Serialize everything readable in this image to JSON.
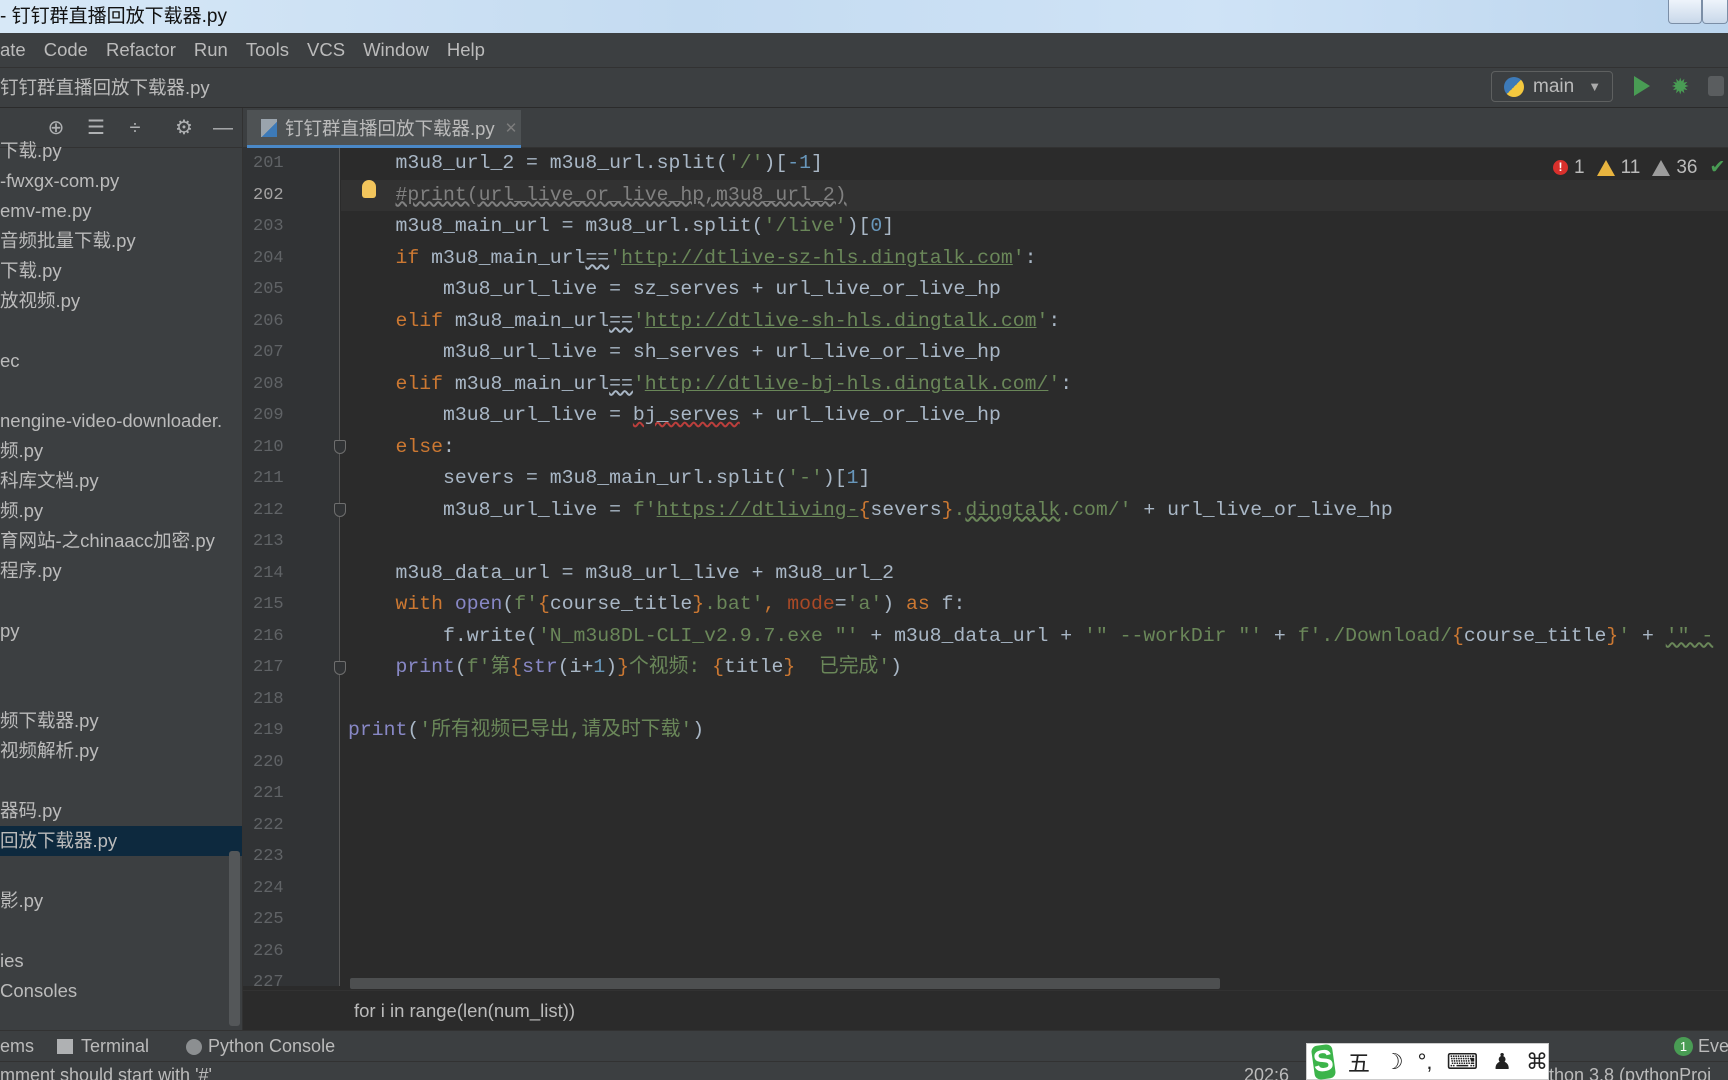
{
  "window": {
    "title": "- 钉钉群直播回放下载器.py"
  },
  "menu": [
    "ate",
    "Code",
    "Refactor",
    "Run",
    "Tools",
    "VCS",
    "Window",
    "Help"
  ],
  "navbar": {
    "file": "钉钉群直播回放下载器.py",
    "run_config": "main"
  },
  "sidebar": {
    "items": [
      "下载.py",
      "-fwxgx-com.py",
      "emv-me.py",
      "音频批量下载.py",
      "下载.py",
      "放视频.py",
      "",
      "ec",
      "",
      "nengine-video-downloader.",
      "频.py",
      "科库文档.py",
      "频.py",
      "育网站-之chinaacc加密.py",
      "程序.py",
      "",
      "py",
      "",
      "",
      "频下载器.py",
      "视频解析.py",
      "",
      "器码.py",
      "回放下载器.py",
      "",
      "影.py",
      "",
      "ies",
      "Consoles"
    ],
    "selected_index": 23
  },
  "editor": {
    "tab": "钉钉群直播回放下载器.py",
    "current_line": 202,
    "problems": {
      "errors": "1",
      "warnings": "11",
      "weak_warnings": "36"
    },
    "lines": [
      {
        "num": "201",
        "tokens": [
          [
            "    m3u8_url_2 = m3u8_url.split(",
            "d"
          ],
          [
            "'/'",
            "s"
          ],
          [
            ")[",
            "d"
          ],
          [
            "-1",
            "n"
          ],
          [
            "]",
            "d"
          ]
        ]
      },
      {
        "num": "202",
        "tokens": [
          [
            "    ",
            "d"
          ],
          [
            "#print(url_live_or_live_hp,m3u8_url_2)",
            "cm"
          ]
        ]
      },
      {
        "num": "203",
        "tokens": [
          [
            "    m3u8_main_url = m3u8_url.split(",
            "d"
          ],
          [
            "'/live'",
            "s"
          ],
          [
            ")[",
            "d"
          ],
          [
            "0",
            "n"
          ],
          [
            "]",
            "d"
          ]
        ]
      },
      {
        "num": "204",
        "tokens": [
          [
            "    ",
            "d"
          ],
          [
            "if",
            "k"
          ],
          [
            " m3u8_main_url",
            "d"
          ],
          [
            "==",
            "d wd"
          ],
          [
            "'",
            "s"
          ],
          [
            "http://dtlive-sz-hls.dingtalk.com",
            "s link"
          ],
          [
            "'",
            "s"
          ],
          [
            ":",
            "d"
          ]
        ]
      },
      {
        "num": "205",
        "tokens": [
          [
            "        m3u8_url_live = sz_serves + url_live_or_live_hp",
            "d"
          ]
        ]
      },
      {
        "num": "206",
        "tokens": [
          [
            "    ",
            "d"
          ],
          [
            "elif",
            "k"
          ],
          [
            " m3u8_main_url",
            "d"
          ],
          [
            "==",
            "d wd"
          ],
          [
            "'",
            "s"
          ],
          [
            "http://dtlive-sh-hls.dingtalk.com",
            "s link"
          ],
          [
            "'",
            "s"
          ],
          [
            ":",
            "d"
          ]
        ]
      },
      {
        "num": "207",
        "tokens": [
          [
            "        m3u8_url_live = sh_serves + url_live_or_live_hp",
            "d"
          ]
        ]
      },
      {
        "num": "208",
        "tokens": [
          [
            "    ",
            "d"
          ],
          [
            "elif",
            "k"
          ],
          [
            " m3u8_main_url",
            "d"
          ],
          [
            "==",
            "d wd"
          ],
          [
            "'",
            "s"
          ],
          [
            "http://dtlive-bj-hls.dingtalk.com/",
            "s link"
          ],
          [
            "'",
            "s"
          ],
          [
            ":",
            "d"
          ]
        ]
      },
      {
        "num": "209",
        "tokens": [
          [
            "        m3u8_url_live = ",
            "d"
          ],
          [
            "bj_serves",
            "d wr"
          ],
          [
            " + url_live_or_live_hp",
            "d"
          ]
        ]
      },
      {
        "num": "210",
        "tokens": [
          [
            "    ",
            "d"
          ],
          [
            "else",
            "k"
          ],
          [
            ":",
            "d"
          ]
        ]
      },
      {
        "num": "211",
        "tokens": [
          [
            "        severs = m3u8_main_url.split(",
            "d"
          ],
          [
            "'-'",
            "s"
          ],
          [
            ")[",
            "d"
          ],
          [
            "1",
            "n"
          ],
          [
            "]",
            "d"
          ]
        ]
      },
      {
        "num": "212",
        "tokens": [
          [
            "        m3u8_url_live = ",
            "d"
          ],
          [
            "f'",
            "s"
          ],
          [
            "https://dtliving-",
            "s link"
          ],
          [
            "{",
            "k"
          ],
          [
            "severs",
            "d"
          ],
          [
            "}",
            "k"
          ],
          [
            ".",
            "s"
          ],
          [
            "dingtalk",
            "s wv"
          ],
          [
            ".com/'",
            "s"
          ],
          [
            " + url_live_or_live_hp",
            "d"
          ]
        ]
      },
      {
        "num": "213",
        "tokens": []
      },
      {
        "num": "214",
        "tokens": [
          [
            "    m3u8_data_url = m3u8_url_live + m3u8_url_2",
            "d"
          ]
        ]
      },
      {
        "num": "215",
        "tokens": [
          [
            "    ",
            "d"
          ],
          [
            "with",
            "k"
          ],
          [
            " ",
            "d"
          ],
          [
            "open",
            "b"
          ],
          [
            "(",
            "d"
          ],
          [
            "f'",
            "s"
          ],
          [
            "{",
            "k"
          ],
          [
            "course_title",
            "d"
          ],
          [
            "}",
            "k"
          ],
          [
            ".bat'",
            "s"
          ],
          [
            ", ",
            "k"
          ],
          [
            "mode",
            "p"
          ],
          [
            "=",
            "d"
          ],
          [
            "'a'",
            "s"
          ],
          [
            ") ",
            "d"
          ],
          [
            "as",
            "k"
          ],
          [
            " f:",
            "d"
          ]
        ]
      },
      {
        "num": "216",
        "tokens": [
          [
            "        f.write(",
            "d"
          ],
          [
            "'N_m3u8DL-CLI_v2.9.7.exe \"'",
            "s"
          ],
          [
            " + m3u8_data_url + ",
            "d"
          ],
          [
            "'\" --workDir \"'",
            "s"
          ],
          [
            " + ",
            "d"
          ],
          [
            "f'./Download/",
            "s"
          ],
          [
            "{",
            "k"
          ],
          [
            "course_title",
            "d"
          ],
          [
            "}",
            "k"
          ],
          [
            "'",
            "s"
          ],
          [
            " + ",
            "d"
          ],
          [
            "'\" -",
            "s wv"
          ]
        ]
      },
      {
        "num": "217",
        "tokens": [
          [
            "    ",
            "d"
          ],
          [
            "print",
            "b"
          ],
          [
            "(",
            "d"
          ],
          [
            "f'第",
            "s"
          ],
          [
            "{",
            "k"
          ],
          [
            "str",
            "b"
          ],
          [
            "(i+",
            "d"
          ],
          [
            "1",
            "n"
          ],
          [
            ")",
            "d"
          ],
          [
            "}",
            "k"
          ],
          [
            "个视频: ",
            "s"
          ],
          [
            "{",
            "k"
          ],
          [
            "title",
            "d"
          ],
          [
            "}",
            "k"
          ],
          [
            "  已完成'",
            "s"
          ],
          [
            ")",
            "d"
          ]
        ]
      },
      {
        "num": "218",
        "tokens": []
      },
      {
        "num": "219",
        "tokens": [
          [
            "print",
            "b"
          ],
          [
            "(",
            "d"
          ],
          [
            "'所有视频已导出,请及时下载'",
            "s"
          ],
          [
            ")",
            "d"
          ]
        ]
      },
      {
        "num": "220",
        "tokens": []
      },
      {
        "num": "221",
        "tokens": []
      },
      {
        "num": "222",
        "tokens": []
      },
      {
        "num": "223",
        "tokens": []
      },
      {
        "num": "224",
        "tokens": []
      },
      {
        "num": "225",
        "tokens": []
      },
      {
        "num": "226",
        "tokens": []
      },
      {
        "num": "227",
        "tokens": []
      }
    ],
    "breadcrumb": "for i in range(len(num_list))"
  },
  "toolwindows": {
    "problems": "ems",
    "terminal": "Terminal",
    "python_console": "Python Console",
    "event_log": "Even",
    "event_count": "1"
  },
  "status": {
    "message": "mment should start with '#'",
    "position": "202:6",
    "interpreter": "thon 3.8 (pythonProj"
  },
  "ime": {
    "items": [
      "五",
      "☽",
      "°,",
      "⌨",
      "♟",
      "⌘"
    ]
  }
}
